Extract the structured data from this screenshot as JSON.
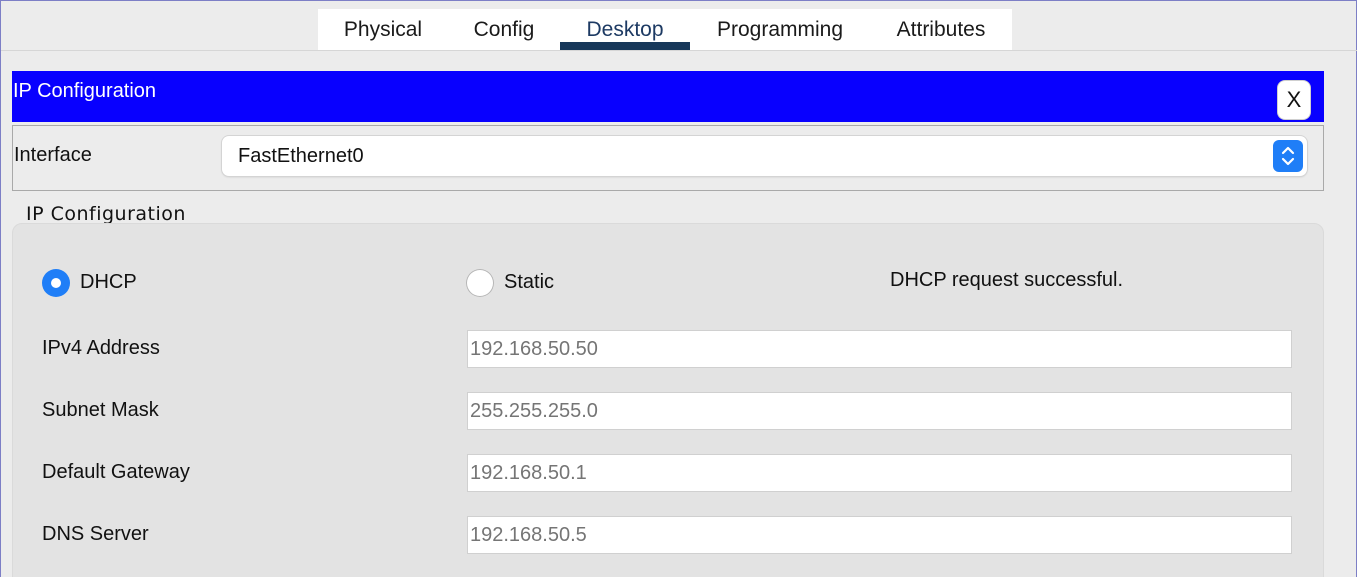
{
  "tabs": [
    {
      "label": "Physical",
      "active": false
    },
    {
      "label": "Config",
      "active": false
    },
    {
      "label": "Desktop",
      "active": true
    },
    {
      "label": "Programming",
      "active": false
    },
    {
      "label": "Attributes",
      "active": false
    }
  ],
  "window": {
    "title": "IP Configuration",
    "close_label": "X",
    "title_color": "#0800ff"
  },
  "interface": {
    "label": "Interface",
    "selected": "FastEthernet0"
  },
  "ip_config": {
    "group_title": "IP Configuration",
    "mode_dhcp_label": "DHCP",
    "mode_static_label": "Static",
    "selected_mode": "DHCP",
    "status_text": "DHCP request successful.",
    "fields": [
      {
        "label": "IPv4 Address",
        "value": "192.168.50.50"
      },
      {
        "label": "Subnet Mask",
        "value": "255.255.255.0"
      },
      {
        "label": "Default Gateway",
        "value": "192.168.50.1"
      },
      {
        "label": "DNS Server",
        "value": "192.168.50.5"
      }
    ]
  },
  "colors": {
    "accent": "#1f7ef7",
    "active_tab_underline": "#17385a"
  }
}
